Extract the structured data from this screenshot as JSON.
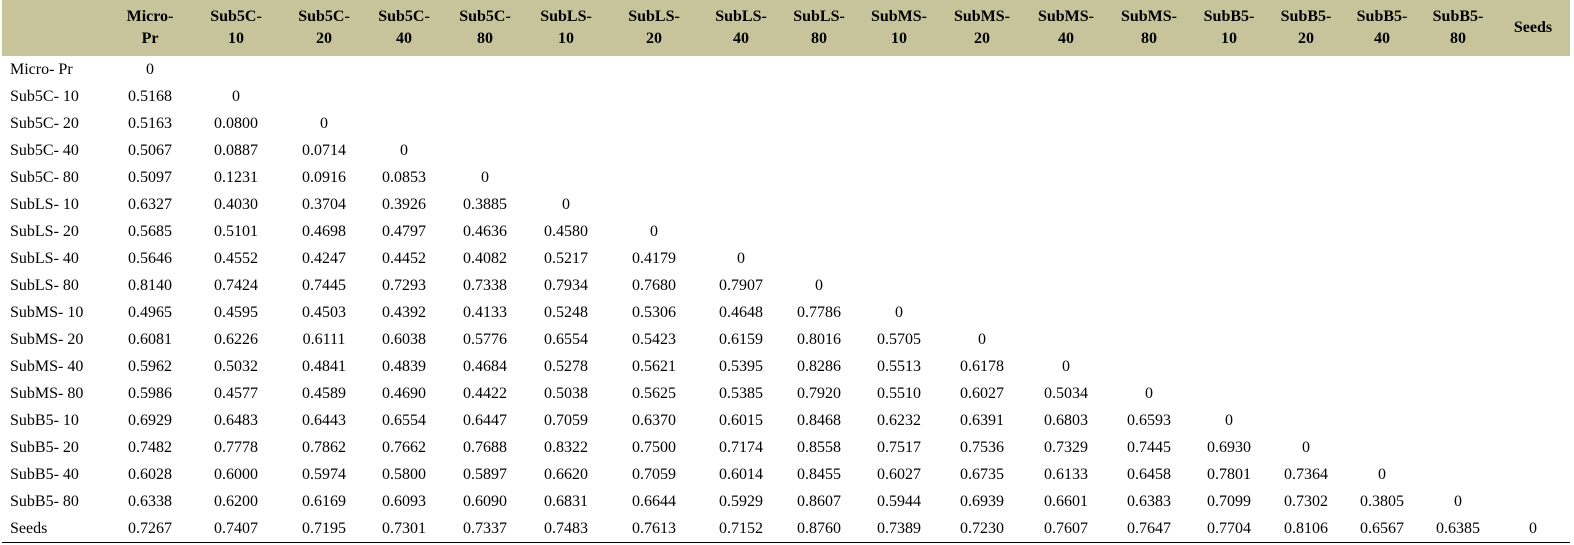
{
  "columns": [
    "Micro-\nPr",
    "Sub5C-\n10",
    "Sub5C-\n20",
    "Sub5C-\n40",
    "Sub5C-\n80",
    "SubLS-\n10",
    "SubLS-\n20",
    "SubLS-\n40",
    "SubLS-\n80",
    "SubMS-\n10",
    "SubMS-\n20",
    "SubMS-\n40",
    "SubMS-\n80",
    "SubB5-\n10",
    "SubB5-\n20",
    "SubB5-\n40",
    "SubB5-\n80",
    "Seeds"
  ],
  "rows": [
    {
      "label": "Micro- Pr",
      "values": [
        "0"
      ]
    },
    {
      "label": "Sub5C- 10",
      "values": [
        "0.5168",
        "0"
      ]
    },
    {
      "label": "Sub5C- 20",
      "values": [
        "0.5163",
        "0.0800",
        "0"
      ]
    },
    {
      "label": "Sub5C- 40",
      "values": [
        "0.5067",
        "0.0887",
        "0.0714",
        "0"
      ]
    },
    {
      "label": "Sub5C- 80",
      "values": [
        "0.5097",
        "0.1231",
        "0.0916",
        "0.0853",
        "0"
      ]
    },
    {
      "label": "SubLS- 10",
      "values": [
        "0.6327",
        "0.4030",
        "0.3704",
        "0.3926",
        "0.3885",
        "0"
      ]
    },
    {
      "label": "SubLS- 20",
      "values": [
        "0.5685",
        "0.5101",
        "0.4698",
        "0.4797",
        "0.4636",
        "0.4580",
        "0"
      ]
    },
    {
      "label": "SubLS- 40",
      "values": [
        "0.5646",
        "0.4552",
        "0.4247",
        "0.4452",
        "0.4082",
        "0.5217",
        "0.4179",
        "0"
      ]
    },
    {
      "label": "SubLS- 80",
      "values": [
        "0.8140",
        "0.7424",
        "0.7445",
        "0.7293",
        "0.7338",
        "0.7934",
        "0.7680",
        "0.7907",
        "0"
      ]
    },
    {
      "label": "SubMS- 10",
      "values": [
        "0.4965",
        "0.4595",
        "0.4503",
        "0.4392",
        "0.4133",
        "0.5248",
        "0.5306",
        "0.4648",
        "0.7786",
        "0"
      ]
    },
    {
      "label": "SubMS- 20",
      "values": [
        "0.6081",
        "0.6226",
        "0.6111",
        "0.6038",
        "0.5776",
        "0.6554",
        "0.5423",
        "0.6159",
        "0.8016",
        "0.5705",
        "0"
      ]
    },
    {
      "label": "SubMS- 40",
      "values": [
        "0.5962",
        "0.5032",
        "0.4841",
        "0.4839",
        "0.4684",
        "0.5278",
        "0.5621",
        "0.5395",
        "0.8286",
        "0.5513",
        "0.6178",
        "0"
      ]
    },
    {
      "label": "SubMS- 80",
      "values": [
        "0.5986",
        "0.4577",
        "0.4589",
        "0.4690",
        "0.4422",
        "0.5038",
        "0.5625",
        "0.5385",
        "0.7920",
        "0.5510",
        "0.6027",
        "0.5034",
        "0"
      ]
    },
    {
      "label": "SubB5- 10",
      "values": [
        "0.6929",
        "0.6483",
        "0.6443",
        "0.6554",
        "0.6447",
        "0.7059",
        "0.6370",
        "0.6015",
        "0.8468",
        "0.6232",
        "0.6391",
        "0.6803",
        "0.6593",
        "0"
      ]
    },
    {
      "label": "SubB5- 20",
      "values": [
        "0.7482",
        "0.7778",
        "0.7862",
        "0.7662",
        "0.7688",
        "0.8322",
        "0.7500",
        "0.7174",
        "0.8558",
        "0.7517",
        "0.7536",
        "0.7329",
        "0.7445",
        "0.6930",
        "0"
      ]
    },
    {
      "label": "SubB5- 40",
      "values": [
        "0.6028",
        "0.6000",
        "0.5974",
        "0.5800",
        "0.5897",
        "0.6620",
        "0.7059",
        "0.6014",
        "0.8455",
        "0.6027",
        "0.6735",
        "0.6133",
        "0.6458",
        "0.7801",
        "0.7364",
        "0"
      ]
    },
    {
      "label": "SubB5- 80",
      "values": [
        "0.6338",
        "0.6200",
        "0.6169",
        "0.6093",
        "0.6090",
        "0.6831",
        "0.6644",
        "0.5929",
        "0.8607",
        "0.5944",
        "0.6939",
        "0.6601",
        "0.6383",
        "0.7099",
        "0.7302",
        "0.3805",
        "0"
      ]
    },
    {
      "label": "Seeds",
      "values": [
        "0.7267",
        "0.7407",
        "0.7195",
        "0.7301",
        "0.7337",
        "0.7483",
        "0.7613",
        "0.7152",
        "0.8760",
        "0.7389",
        "0.7230",
        "0.7607",
        "0.7647",
        "0.7704",
        "0.8106",
        "0.6567",
        "0.6385",
        "0"
      ]
    }
  ]
}
